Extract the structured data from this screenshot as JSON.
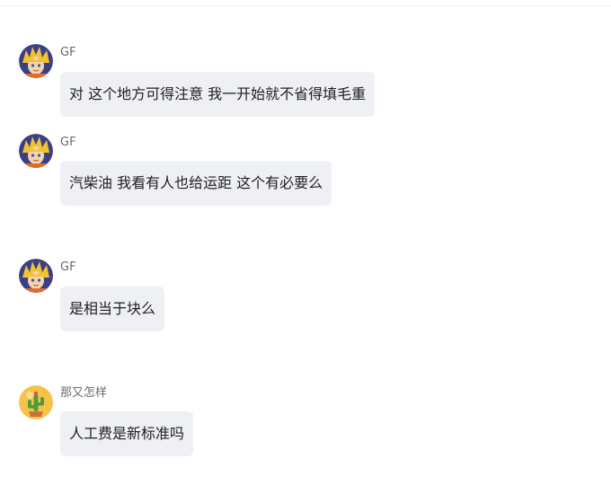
{
  "messages": [
    {
      "sender": "GF",
      "avatar_icon": "anime-character-avatar-icon",
      "text": "对 这个地方可得注意 我一开始就不省得填毛重"
    },
    {
      "sender": "GF",
      "avatar_icon": "anime-character-avatar-icon",
      "text": "汽柴油 我看有人也给运距 这个有必要么"
    },
    {
      "sender": "GF",
      "avatar_icon": "anime-character-avatar-icon",
      "text": "是相当于块么"
    },
    {
      "sender": "那又怎样",
      "avatar_icon": "cactus-avatar-icon",
      "text": "人工费是新标准吗"
    }
  ],
  "colors": {
    "bubble_background": "#eef0f4",
    "sender_name": "#6b6b6b",
    "message_text": "#1f1f1f"
  }
}
